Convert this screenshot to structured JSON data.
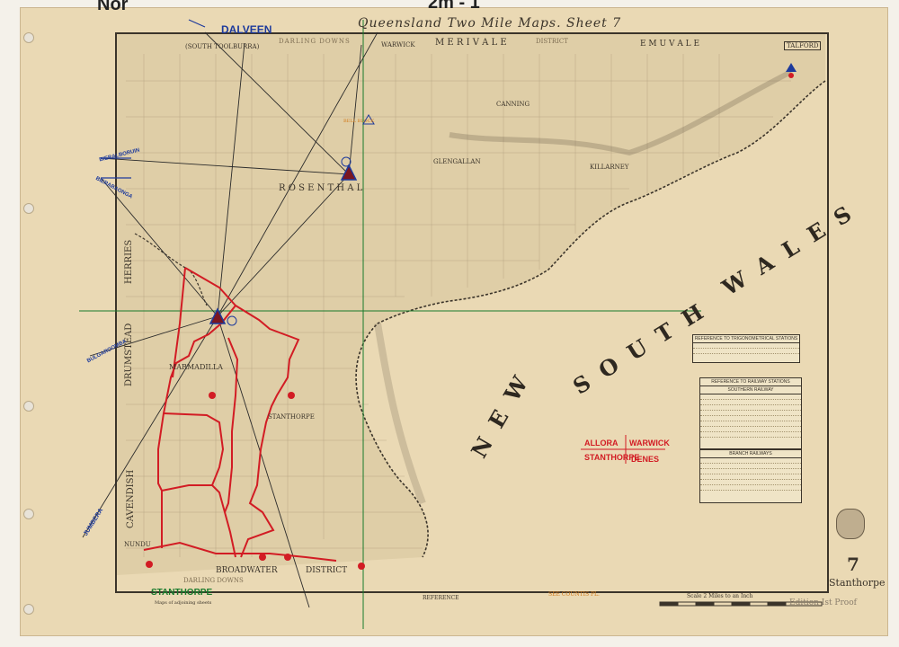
{
  "header": {
    "top_left_handwriting": "Nor",
    "top_center_handwriting": "2m - 1",
    "title": "Queensland Two Mile Maps. Sheet 7"
  },
  "places": {
    "dalveen": "DALVEEN",
    "south_toolburra": "(SOUTH TOOLBURRA)",
    "darling_downs_top": "DARLING DOWNS",
    "warwick": "WARWICK",
    "merivale": "M E R I V A L E",
    "district": "DISTRICT",
    "emu_vale": "E M U   V A L E",
    "talford": "TALFORD",
    "rosenthal": "R O S E N T H A L",
    "killarney": "KILLARNEY",
    "canning": "CANNING",
    "glengallan": "GLENGALLAN",
    "herries": "HERRIES",
    "drumstead": "DRUMSTEAD",
    "cavendish": "CAVENDISH",
    "marmadilla": "MARMADILLA",
    "stanthorpe_map": "STANTHORPE",
    "broadwater": "BROADWATER",
    "district_bottom": "DISTRICT",
    "darling_downs_bottom": "DARLING DOWNS",
    "nundubbermere": "NUNDU",
    "new": "N E W",
    "south": "S O U T H",
    "wales": "W A L E S"
  },
  "annotations": {
    "bieralboruin": "BIERALBORUIN",
    "bierabaonga": "BIERABAONGA",
    "bulgaroomba": "BULGAROOMBA",
    "jumbera": "JUMBERA",
    "allora": "ALLORA",
    "warwick": "WARWICK",
    "stanthorpe": "STANTHORPE",
    "dunes": "DENES",
    "stanthorpe_green": "STANTHORPE",
    "trig_label": "BELL BLOCK",
    "red_note": "SEE COUNTIS PL."
  },
  "tables": {
    "trig": "REFERENCE TO TRIGONOMETRICAL STATIONS",
    "railway": "REFERENCE TO RAILWAY STATIONS",
    "railway_sub": "SOUTHERN RAILWAY",
    "branch": "BRANCH RAILWAYS"
  },
  "footer": {
    "sheet_number": "7",
    "sheet_name": "Stanthorpe",
    "stamp": "Edition Ist Proof",
    "scale": "Scale 2 Miles to an Inch",
    "reference": "REFERENCE",
    "index_label": "Maps of adjoining sheets"
  },
  "colors": {
    "paper": "#ead9b4",
    "ink": "#3b342a",
    "red": "#d21c24",
    "blue": "#1d3a9c",
    "green": "#187a2b"
  }
}
